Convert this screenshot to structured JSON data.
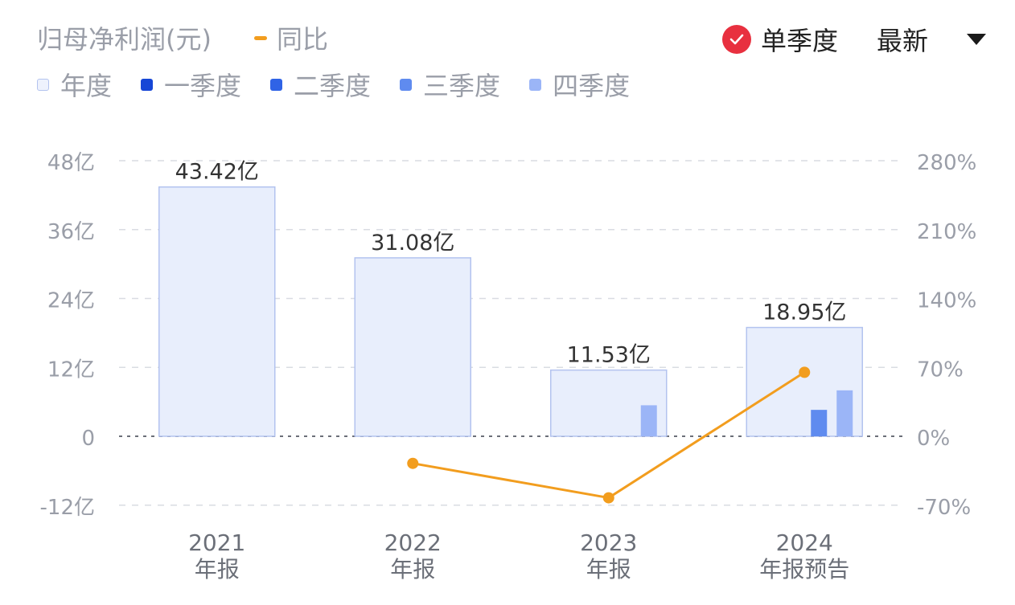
{
  "header": {
    "title": "归母净利润(元)",
    "yoy_label": "同比",
    "single_quarter_label": "单季度",
    "latest_label": "最新"
  },
  "legend": [
    {
      "label": "年度"
    },
    {
      "label": "一季度"
    },
    {
      "label": "二季度"
    },
    {
      "label": "三季度"
    },
    {
      "label": "四季度"
    }
  ],
  "colors": {
    "annual_fill": "#e8eefc",
    "annual_border": "#b3c3ef",
    "q1": "#1646d6",
    "q2": "#2f63e6",
    "q3": "#5f8bef",
    "q4": "#9bb5f7",
    "yoy_line": "#f29d1e",
    "check": "#e8303f"
  },
  "chart_data": {
    "type": "bar",
    "categories": [
      [
        "2021",
        "年报"
      ],
      [
        "2022",
        "年报"
      ],
      [
        "2023",
        "年报"
      ],
      [
        "2024",
        "年报预告"
      ]
    ],
    "annual_values": [
      43.42,
      31.08,
      11.53,
      18.95
    ],
    "annual_labels": [
      "43.42亿",
      "31.08亿",
      "11.53亿",
      "18.95亿"
    ],
    "quarter_series": [
      {
        "name": "三季度",
        "values": [
          null,
          null,
          null,
          4.6
        ]
      },
      {
        "name": "四季度",
        "values": [
          null,
          null,
          5.4,
          8.0
        ]
      }
    ],
    "yoy_line": {
      "name": "同比",
      "values": [
        null,
        -27.5,
        -62.5,
        65.0
      ]
    },
    "left_axis": {
      "ticks": [
        48,
        36,
        24,
        12,
        0,
        -12
      ],
      "tick_labels": [
        "48亿",
        "36亿",
        "24亿",
        "12亿",
        "0",
        "-12亿"
      ],
      "ylim": [
        -12,
        48
      ]
    },
    "right_axis": {
      "ticks": [
        280,
        210,
        140,
        70,
        0,
        -70
      ],
      "tick_labels": [
        "280%",
        "210%",
        "140%",
        "70%",
        "0%",
        "-70%"
      ],
      "ylim": [
        -70,
        280
      ]
    },
    "grid": true
  }
}
